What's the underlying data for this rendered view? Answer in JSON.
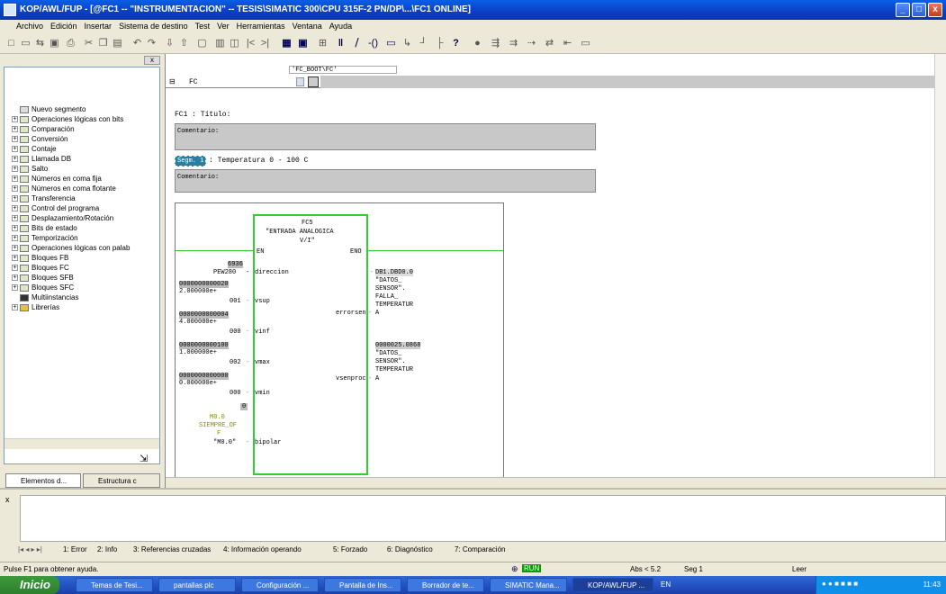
{
  "window": {
    "title": "KOP/AWL/FUP - [@FC1 -- \"INSTRUMENTACION\" -- TESIS\\SIMATIC 300\\CPU 315F-2 PN/DP\\...\\FC1  ONLINE]",
    "buttons": [
      "_",
      "□",
      "x"
    ]
  },
  "menu": [
    "Archivo",
    "Edición",
    "Insertar",
    "Sistema de destino",
    "Test",
    "Ver",
    "Herramientas",
    "Ventana",
    "Ayuda"
  ],
  "tree": [
    {
      "label": "Nuevo segmento",
      "expand": ""
    },
    {
      "label": "Operaciones lógicas con bits",
      "expand": "+"
    },
    {
      "label": "Comparación",
      "expand": "+"
    },
    {
      "label": "Conversión",
      "expand": "+"
    },
    {
      "label": "Contaje",
      "expand": "+"
    },
    {
      "label": "Llamada DB",
      "expand": "+"
    },
    {
      "label": "Salto",
      "expand": "+"
    },
    {
      "label": "Números en coma fija",
      "expand": "+"
    },
    {
      "label": "Números en coma flotante",
      "expand": "+"
    },
    {
      "label": "Transferencia",
      "expand": "+"
    },
    {
      "label": "Control del programa",
      "expand": "+"
    },
    {
      "label": "Desplazamiento/Rotación",
      "expand": "+"
    },
    {
      "label": "Bits de estado",
      "expand": "+"
    },
    {
      "label": "Temporización",
      "expand": "+"
    },
    {
      "label": "Operaciones lógicas con palab",
      "expand": "+"
    },
    {
      "label": "Bloques FB",
      "expand": "+"
    },
    {
      "label": "Bloques FC",
      "expand": "+"
    },
    {
      "label": "Bloques SFB",
      "expand": "+"
    },
    {
      "label": "Bloques SFC",
      "expand": "+"
    },
    {
      "label": "Multiinstancias",
      "expand": ""
    },
    {
      "label": "Librerías",
      "expand": "+"
    }
  ],
  "left_tabs": [
    "Elementos d...",
    "Estructura c"
  ],
  "editor": {
    "path": "'FC_BOOT\\FC'",
    "block": "FC",
    "fc_title": "FC1 : Título:",
    "comment1": "Comentario:",
    "segment_tag": "Segm. 1",
    "segment_title": ": Temperatura 0 - 100 C",
    "comment2": "Comentario:"
  },
  "ladder": {
    "block_name": "FC5",
    "block_desc_1": "\"ENTRADA ANALOGICA",
    "block_desc_2": "V/I\"",
    "en": "EN",
    "eno": "ENO",
    "inputs": {
      "dir_val": "6936",
      "dir_addr": "PEW280",
      "dir_pin": "direccion",
      "vsup_bits": "0000000000020",
      "vsup_val": "2.000000e+",
      "vsup_addr": "001",
      "vsup_pin": "vsup",
      "vinf_bits": "0000000000004",
      "vinf_val": "4.000000e+",
      "vinf_addr": "000",
      "vinf_pin": "vinf",
      "vmax_bits": "0000000000100",
      "vmax_val": "1.000000e+",
      "vmax_addr": "002",
      "vmax_pin": "vmax",
      "vmin_bits": "0000000000000",
      "vmin_val": "0.000000e+",
      "vmin_addr": "000",
      "vmin_pin": "vmin",
      "bip_state": "0",
      "bip_addr": "M0.0",
      "bip_sym1": "SIEMPRE_OF",
      "bip_sym2": "F",
      "bip_label": "\"M0.0\"",
      "bip_pin": "bipolar"
    },
    "outputs": {
      "err_addr": "DB1.DBD0.0",
      "err_sym1": "\"DATOS_",
      "err_sym2": "SENSOR\".",
      "err_sym3": "FALLA_",
      "err_sym4": "TEMPERATUR",
      "err_sym5": "A",
      "err_pin": "errorsen",
      "vse_val": "0000025.0868",
      "vse_sym1": "\"DATOS_",
      "vse_sym2": "SENSOR\".",
      "vse_sym3": "TEMPERATUR",
      "vse_sym4": "A",
      "vse_pin": "vsenproc"
    }
  },
  "bottom_tabs": [
    "1: Error",
    "2: Info",
    "3: Referencias cruzadas",
    "4: Información operando",
    "5: Forzado",
    "6: Diagnóstico",
    "7: Comparación"
  ],
  "status": {
    "help": "Pulse F1 para obtener ayuda.",
    "run": "RUN",
    "abs": "Abs < 5.2",
    "seg": "Seg 1",
    "mode": "Leer"
  },
  "taskbar": {
    "start": "Inicio",
    "tasks": [
      "Temas de Tesi...",
      "pantallas plc",
      "Configuración ...",
      "Pantalla de Ins...",
      "Borrador de te...",
      "SIMATIC Mana...",
      "KOP/AWL/FUP ..."
    ],
    "lang": "EN",
    "time": "11:43"
  },
  "colors": {
    "titlebar": "#0a4fd8",
    "segment_tag_bg": "#2a7fa0",
    "block_border": "#33cc33",
    "run_green": "#00a000"
  }
}
